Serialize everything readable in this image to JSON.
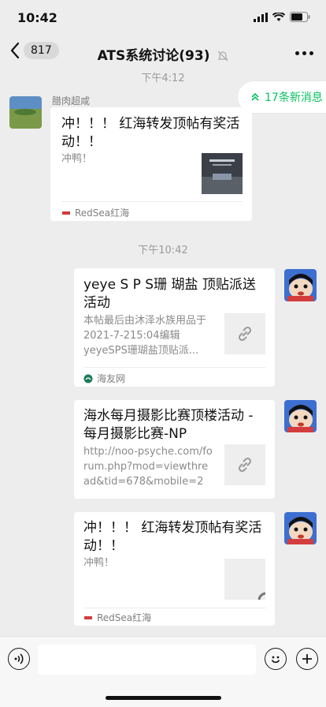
{
  "status_bar": {
    "time": "10:42"
  },
  "nav": {
    "back_badge": "817",
    "title": "ATS系统讨论(93)"
  },
  "chat": {
    "time_1": "下午4:12",
    "time_2": "下午10:42",
    "new_messages": "17条新消息",
    "sender_name": "腊肉超咸",
    "messages": [
      {
        "title": "冲！！！ 红海转发顶帖有奖活动！！",
        "desc": "冲鸭！",
        "source": "RedSea红海"
      },
      {
        "title": "yeye S P S珊 瑚盐 顶贴派送活动",
        "desc": "本帖最后由沐泽水族用品于2021-7-215:04编辑 yeyeSPS珊瑚盐顶贴派...",
        "source": "海友网"
      },
      {
        "title": "海水每月摄影比赛顶楼活动 - 每月摄影比赛-NP",
        "desc": "http://noo-psyche.com/forum.php?mod=viewthread&tid=678&mobile=2"
      },
      {
        "title": "冲！！！ 红海转发顶帖有奖活动！！",
        "desc": "冲鸭！",
        "source": "RedSea红海"
      }
    ]
  },
  "icons": {
    "back": "chevron-left-icon",
    "mute": "bell-slash-icon",
    "more": "ellipsis-icon",
    "new_messages": "double-chevron-up-icon",
    "link": "link-icon",
    "voice": "voice-icon",
    "emoji": "smile-icon",
    "add": "plus-icon"
  },
  "colors": {
    "accent_green": "#07c160",
    "background": "#ededed",
    "card": "#ffffff"
  }
}
